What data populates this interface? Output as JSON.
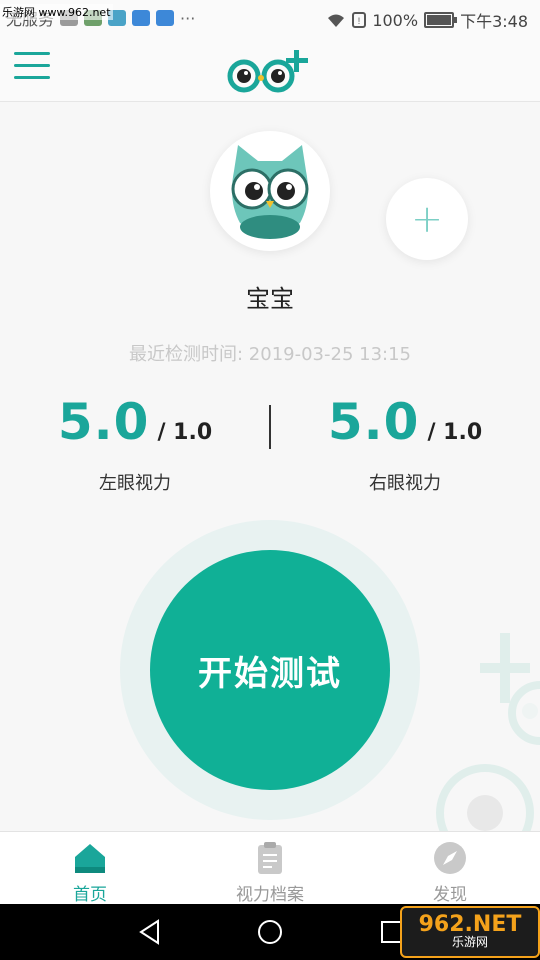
{
  "status_bar": {
    "carrier": "无服务",
    "battery": "100%",
    "time": "下午3:48",
    "dots": "···"
  },
  "watermark_top": "乐游网 www.962.net",
  "header": {
    "menu_icon": "hamburger-icon",
    "logo": "owl-eyes-plus-logo"
  },
  "profile": {
    "name": "宝宝",
    "last_test_label": "最近检测时间: 2019-03-25 13:15",
    "add_icon": "plus-icon"
  },
  "vision": {
    "left": {
      "value": "5.0",
      "ref": "/ 1.0",
      "label": "左眼视力"
    },
    "right": {
      "value": "5.0",
      "ref": "/ 1.0",
      "label": "右眼视力"
    }
  },
  "start_button_label": "开始测试",
  "tabs": [
    {
      "label": "首页",
      "icon": "home-icon",
      "active": true
    },
    {
      "label": "视力档案",
      "icon": "clipboard-icon",
      "active": false
    },
    {
      "label": "发现",
      "icon": "compass-icon",
      "active": false
    }
  ],
  "watermark_bottom": {
    "top": "962.NET",
    "bottom": "乐游网"
  },
  "colors": {
    "accent": "#1aa69a",
    "button": "#10b096",
    "ring": "#e8f2f1",
    "muted": "#c8c8c8"
  }
}
